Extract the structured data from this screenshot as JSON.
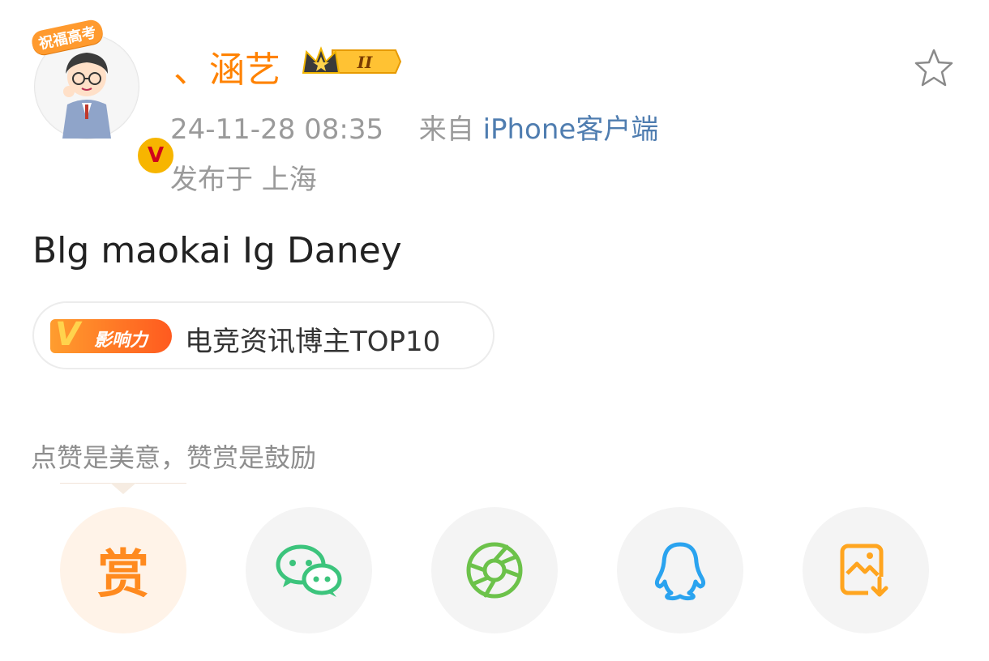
{
  "post": {
    "avatar_badge": "祝福高考",
    "avatar_verified": "V",
    "username": "、涵艺",
    "level_badge": "II",
    "timestamp": "24-11-28 08:35",
    "source_prefix": "来自",
    "source_client": "iPhone客户端",
    "location": "发布于 上海",
    "text": "Blg maokai Ig Daney"
  },
  "tag": {
    "badge_v": "V",
    "badge_label": "影响力",
    "text": "电竞资讯博主TOP10"
  },
  "encourage_text": "点赞是美意，赞赏是鼓励",
  "actions": {
    "reward_label": "赏",
    "icons": [
      "favorite-star-icon",
      "wechat-icon",
      "moments-icon",
      "qq-icon",
      "save-image-icon"
    ]
  },
  "colors": {
    "username": "#ff8200",
    "client_link": "#4f7db0",
    "reward": "#ff8a1f",
    "wechat": "#3cc47c",
    "moments": "#6cc24a",
    "qq": "#2aa3ef",
    "save": "#ffa51f"
  }
}
